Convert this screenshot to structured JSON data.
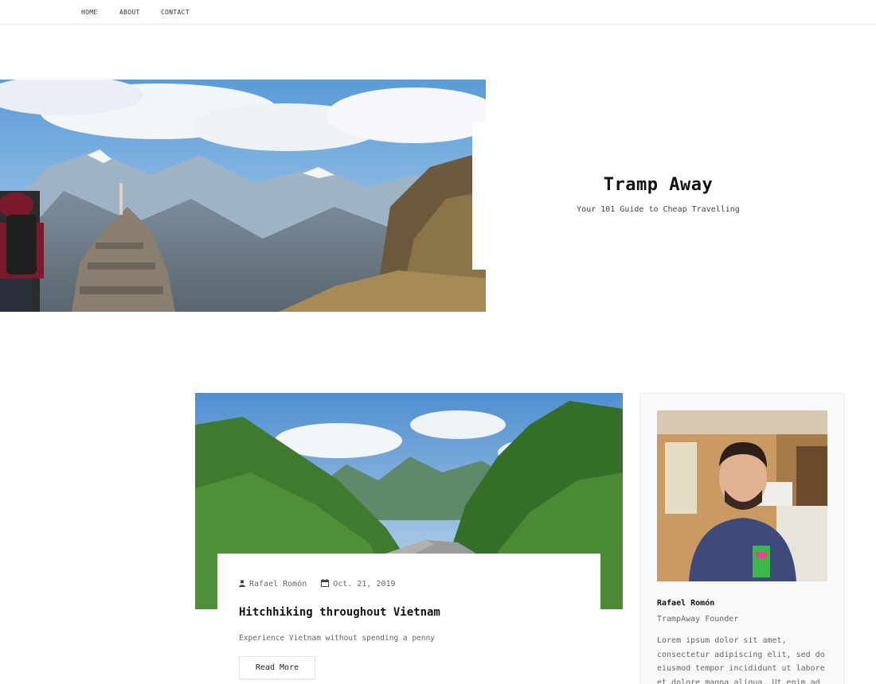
{
  "nav": {
    "items": [
      {
        "label": "HOME"
      },
      {
        "label": "ABOUT"
      },
      {
        "label": "CONTACT"
      }
    ]
  },
  "hero": {
    "title": "Tramp Away",
    "subtitle": "Your 101 Guide to Cheap Travelling"
  },
  "post": {
    "author": "Rafael Romón",
    "date": "Oct. 21, 2019",
    "title": "Hitchhiking throughout Vietnam",
    "excerpt": "Experience Vietnam without spending a penny",
    "read_more_label": "Read More",
    "author_icon": "user-icon",
    "date_icon": "calendar-icon"
  },
  "author_card": {
    "name": "Rafael Romón",
    "role": "TrampAway Founder",
    "bio": "Lorem ipsum dolor sit amet, consectetur adipiscing elit, sed do eiusmod tempor incididunt ut labore et dolore magna aliqua. Ut enim ad"
  },
  "colors": {
    "background": "#ffffff",
    "text": "#222222",
    "muted": "#666666",
    "card_bg": "#f9f9fb",
    "border": "#ececec"
  }
}
